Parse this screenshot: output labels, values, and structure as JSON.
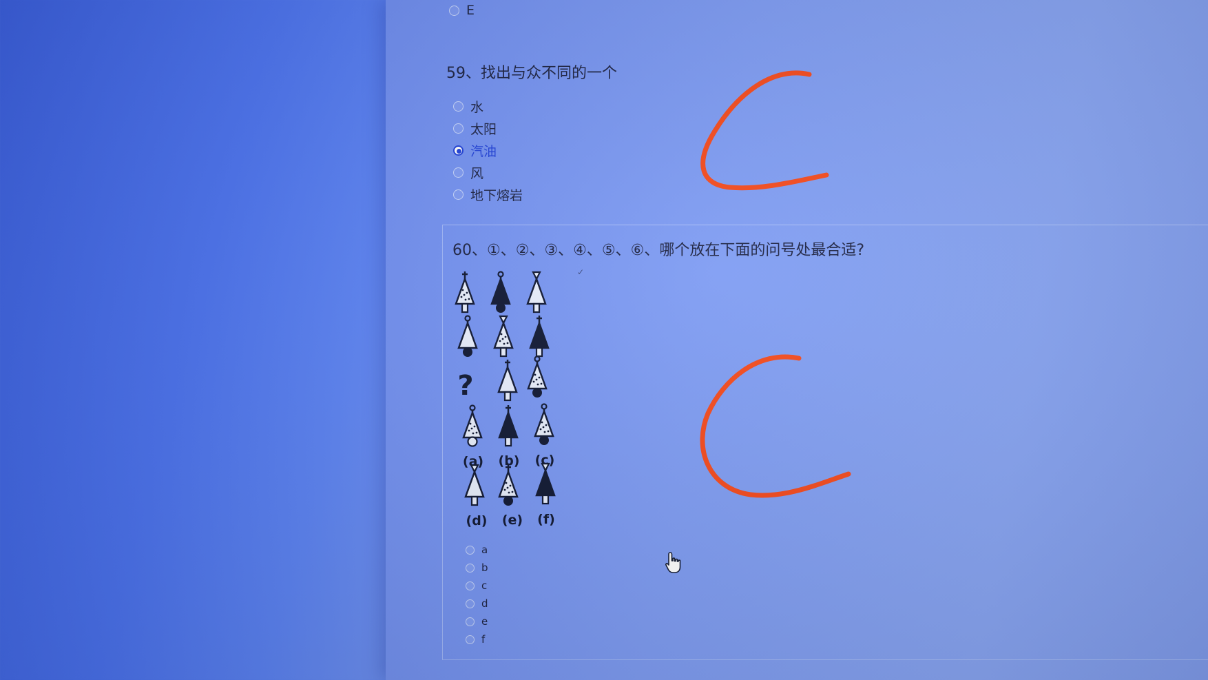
{
  "prev_question": {
    "last_option": "E"
  },
  "q59": {
    "title": "59、找出与众不同的一个",
    "options": [
      "水",
      "太阳",
      "汽油",
      "风",
      "地下熔岩"
    ],
    "selected_index": 2
  },
  "q60": {
    "title": "60、①、②、③、④、⑤、⑥、哪个放在下面的问号处最合适?",
    "figure": {
      "question_mark": "?",
      "answer_labels": [
        "(a)",
        "(b)",
        "(c)",
        "(d)",
        "(e)",
        "(f)"
      ]
    },
    "options": [
      "a",
      "b",
      "c",
      "d",
      "e",
      "f"
    ]
  },
  "colors": {
    "annotation": "#f4481a",
    "selected_radio": "#1e3fd8"
  },
  "icons": [
    "hand-pointer-icon"
  ]
}
